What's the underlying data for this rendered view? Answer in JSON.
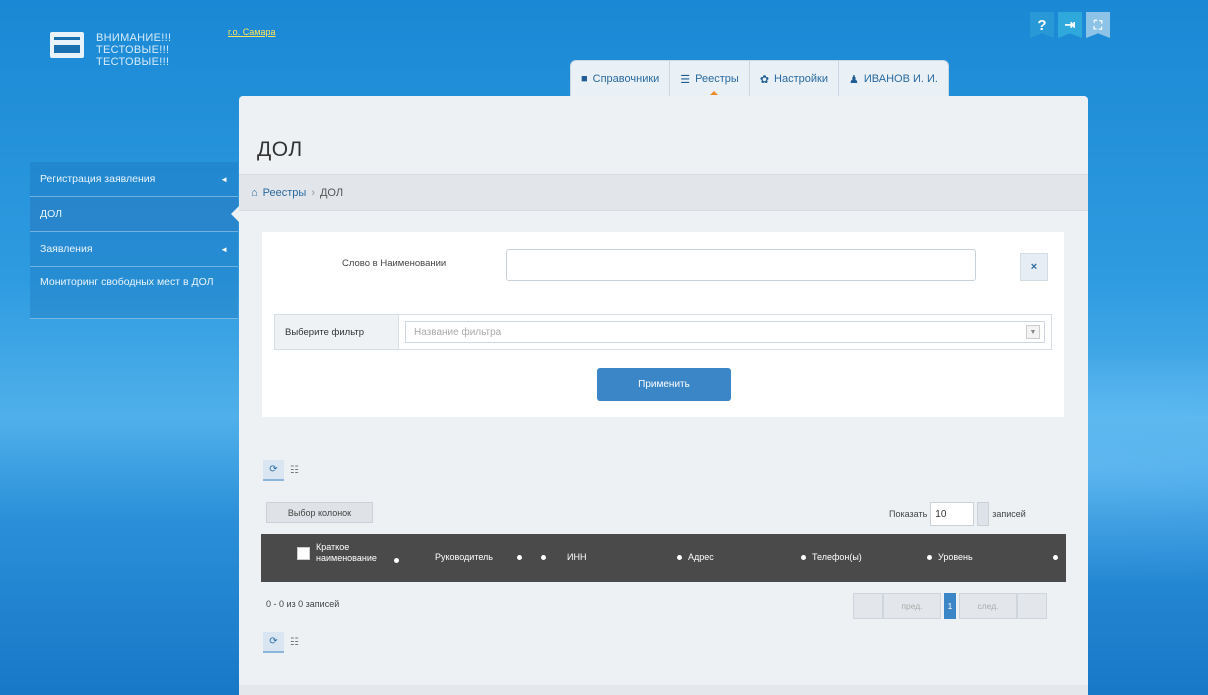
{
  "brand": {
    "line1": "ВНИМАНИЕ!!!",
    "line2": "ТЕСТОВЫЕ!!!",
    "line3": "ТЕСТОВЫЕ!!!",
    "city": "г.о. Самара"
  },
  "top_icons": {
    "help": "?",
    "exit": "⇥",
    "fullscreen": "⛶"
  },
  "topnav": {
    "tabs": [
      {
        "icon": "book-icon",
        "glyph": "■",
        "label": "Справочники"
      },
      {
        "icon": "list-icon",
        "glyph": "☰",
        "label": "Реестры"
      },
      {
        "icon": "gear-icon",
        "glyph": "✿",
        "label": "Настройки"
      },
      {
        "icon": "user-icon",
        "glyph": "♟",
        "label": "ИВАНОВ И. И."
      }
    ]
  },
  "sidebar": {
    "items": [
      {
        "label": "Регистрация заявления",
        "arrow": "◄"
      },
      {
        "label": "ДОЛ"
      },
      {
        "label": "Заявления",
        "arrow": "◄"
      },
      {
        "label": "Мониторинг свободных мест в ДОЛ"
      }
    ]
  },
  "page": {
    "title": "ДОЛ",
    "breadcrumb": {
      "home_icon": "⌂",
      "root": "Реестры",
      "sep": "›",
      "current": "ДОЛ"
    }
  },
  "filter": {
    "word_label": "Слово в Наименовании",
    "word_value": "",
    "clear_label": "×",
    "select_label": "Выберите фильтр",
    "select_placeholder": "Название фильтра",
    "apply_label": "Применить"
  },
  "table": {
    "tool_refresh": "⟳",
    "tool_columns": "☷",
    "columns_button": "Выбор колонок",
    "show_label": "Показать",
    "show_value": "10",
    "records_label": "записей",
    "headers": [
      "Краткое наименование",
      "Руководитель",
      "ИНН",
      "Адрес",
      "Телефон(ы)",
      "Уровень"
    ],
    "info": "0 - 0 из 0 записей",
    "pager": {
      "first": "",
      "prev": "пред.",
      "current": "1",
      "next": "след.",
      "last": ""
    }
  }
}
